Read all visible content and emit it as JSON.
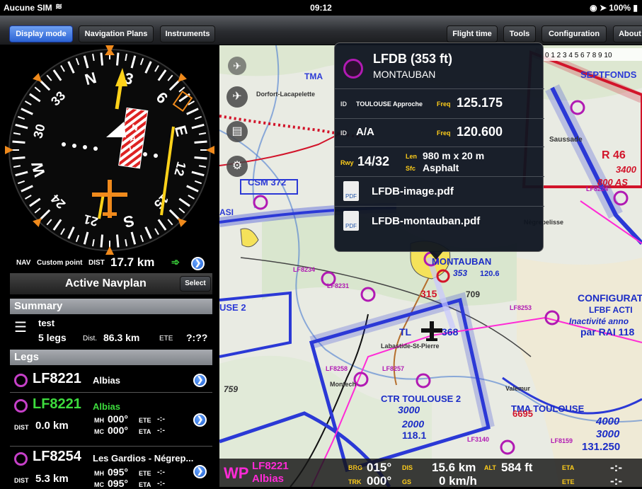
{
  "status": {
    "carrier": "Aucune SIM",
    "time": "09:12",
    "battery": "100%"
  },
  "toolbar": {
    "display_mode": "Display mode",
    "navigation_plans": "Navigation Plans",
    "instruments": "Instruments",
    "flight_time": "Flight time",
    "tools": "Tools",
    "configuration": "Configuration",
    "about": "About"
  },
  "compass": {
    "labels": [
      "N",
      "3",
      "6",
      "E",
      "12",
      "15",
      "S",
      "21",
      "24",
      "W",
      "30",
      "33"
    ],
    "plane_text": "NAV"
  },
  "nav": {
    "label": "NAV",
    "point": "Custom point",
    "dist_label": "DIST",
    "dist": "17.7 km"
  },
  "navplan": {
    "title": "Active Navplan",
    "select": "Select"
  },
  "summary": {
    "header": "Summary",
    "name": "test",
    "legs": "5 legs",
    "dist_label": "Dist.",
    "dist": "86.3 km",
    "ete_label": "ETE",
    "ete": "?:??"
  },
  "legs": {
    "header": "Legs",
    "items": [
      {
        "id": "LF8221",
        "name": "Albias",
        "dist_label": "DIST",
        "dist": "",
        "mh_label": "MH",
        "mh": "",
        "ete_label": "ETE",
        "ete": "",
        "mc_label": "MC",
        "mc": "",
        "eta_label": "ETA",
        "eta": ""
      },
      {
        "id": "LF8221",
        "name": "Albias",
        "dist_label": "DIST",
        "dist": "0.0 km",
        "mh_label": "MH",
        "mh": "000°",
        "ete_label": "ETE",
        "ete": "-:-",
        "mc_label": "MC",
        "mc": "000°",
        "eta_label": "ETA",
        "eta": "-:-"
      },
      {
        "id": "LF8254",
        "name": "Les Gardios - Négrep...",
        "dist_label": "DIST",
        "dist": "5.3 km",
        "mh_label": "MH",
        "mh": "095°",
        "ete_label": "ETE",
        "ete": "-:-",
        "mc_label": "MC",
        "mc": "095°",
        "eta_label": "ETA",
        "eta": "-:-"
      }
    ]
  },
  "popup": {
    "title": "LFDB (353 ft)",
    "subtitle": "MONTAUBAN",
    "id_label": "ID",
    "freq_label": "Freq",
    "id1": "TOULOUSE Approche",
    "freq1": "125.175",
    "id2": "A/A",
    "freq2": "120.600",
    "rwy_label": "Rwy",
    "rwy": "14/32",
    "len_label": "Len",
    "len": "980 m x 20 m",
    "sfc_label": "Sfc",
    "sfc": "Asphalt",
    "doc1": "LFDB-image.pdf",
    "doc2": "LFDB-montauban.pdf"
  },
  "map": {
    "labels": [
      "TMA",
      "Dorfort-Lacapelette",
      "SEPTFONDS",
      "CSM 372",
      "ASI",
      "USE 2",
      "MONTAUBAN",
      "353",
      "120.6",
      "315",
      "709",
      "LF8231",
      "LF8234",
      "LF8253",
      "LF8258",
      "LF8257",
      "CTR TOULOUSE 2",
      "3000",
      "2000",
      "118.1",
      "TMA TOULOUSE",
      "TL",
      "368",
      "LF3140",
      "4000",
      "3000",
      "131.250",
      "LF8159",
      "R 46",
      "3400",
      "800 AS",
      "CONFIGURAT",
      "LFBF ACTI",
      "Inactivité anno",
      "par RAI 118",
      "LF8224",
      "Nègrepelisse",
      "Saussade",
      "Valemur",
      "Labastide-St-Pierre",
      "6695",
      "759",
      "Montech"
    ]
  },
  "bottom": {
    "wp": "WP",
    "wp_id": "LF8221",
    "wp_name": "Albias",
    "brg_label": "BRG",
    "brg": "015°",
    "trk_label": "TRK",
    "trk": "000°",
    "dis_label": "DIS",
    "dis": "15.6 km",
    "gs_label": "GS",
    "gs": "0 km/h",
    "alt_label": "ALT",
    "alt": "584 ft",
    "eta_label": "ETA",
    "eta": "-:-",
    "ete_label": "ETE",
    "ete": "-:-"
  },
  "colors": {
    "accent": "#2c64d4",
    "magenta": "#c640c8",
    "green": "#3ddc3d",
    "airspace_blue": "#2b39d6",
    "airspace_red": "#d2142a"
  }
}
